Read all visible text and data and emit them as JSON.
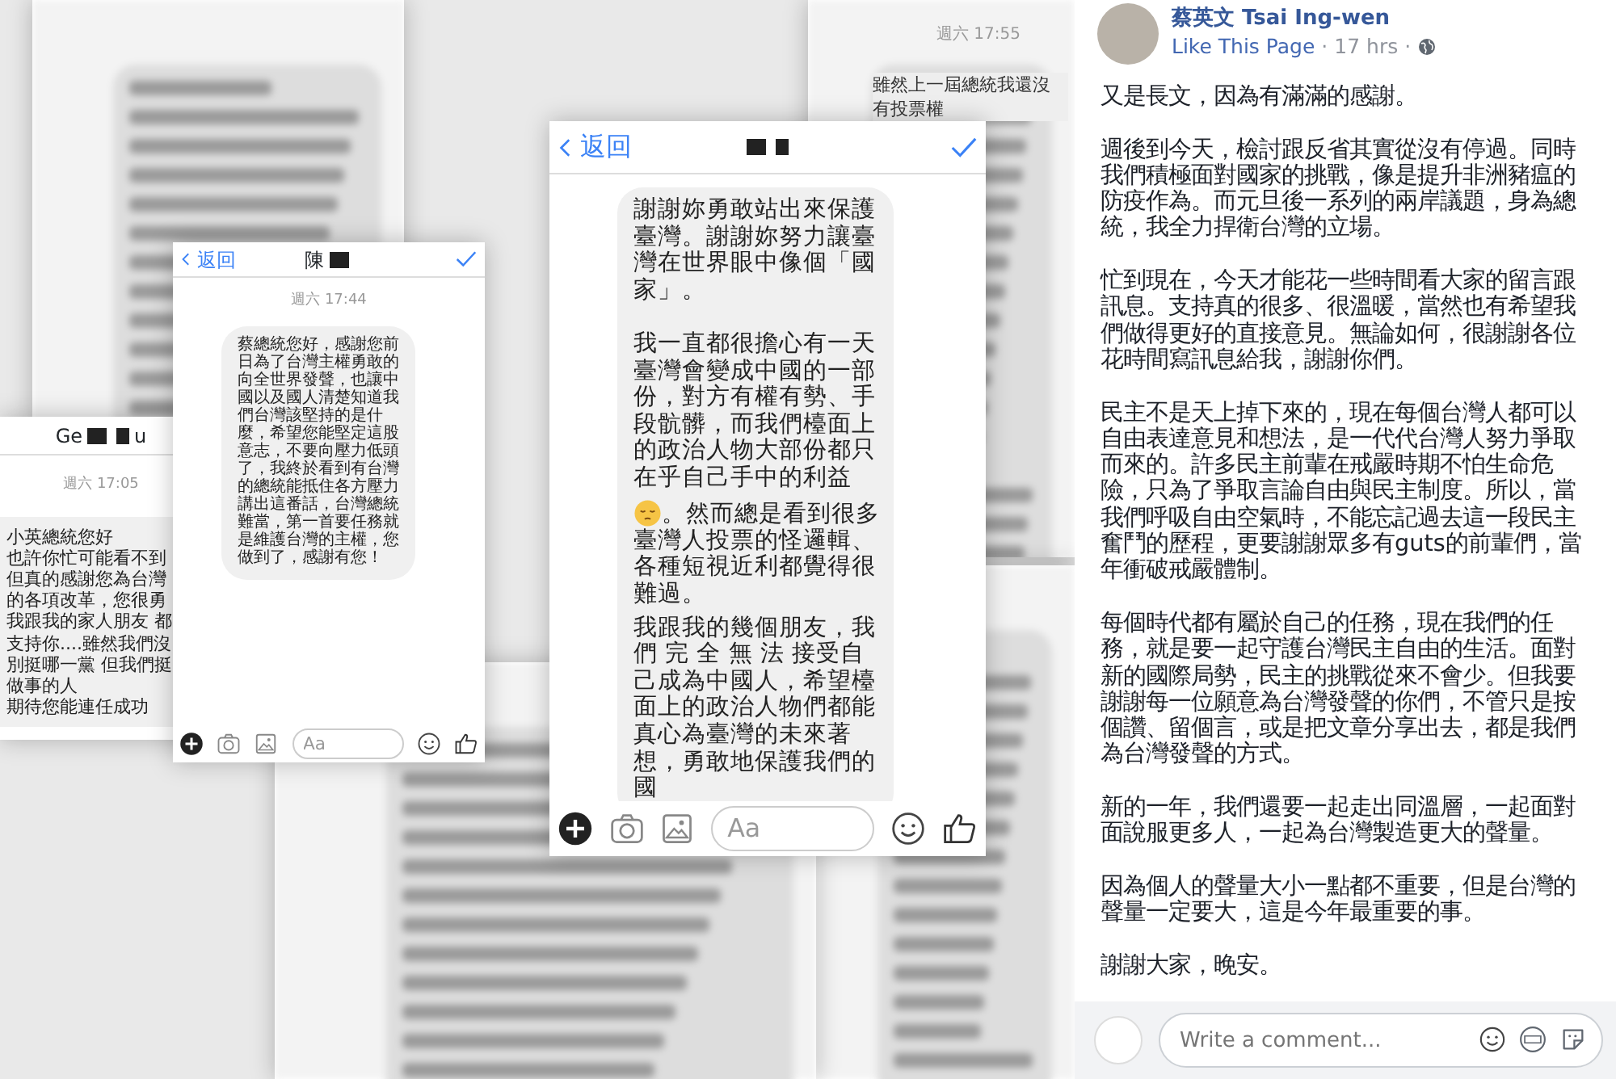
{
  "chats": [
    {
      "kind": "blurred"
    },
    {
      "kind": "blurred",
      "timestamp": "週六 17:55",
      "lines": [
        "雖然上一屆總統我還沒",
        "有投票權"
      ]
    },
    {
      "kind": "blurred"
    },
    {
      "kind": "blurred"
    },
    {
      "kind": "messenger",
      "title_start": "Ge",
      "title_end": "u",
      "timestamp": "週六 17:05",
      "lines": [
        "小英總統您好",
        "也許你忙可能看不到",
        "但真的感謝您為台灣",
        "的各項改革，您很勇",
        "我跟我的家人朋友 都",
        "支持你....雖然我們沒",
        "別挺哪一黨 但我們挺",
        "做事的人",
        "期待您能連任成功"
      ]
    },
    {
      "kind": "messenger",
      "back": "返回",
      "title_start": "陳",
      "timestamp": "週六 17:44",
      "paragraphs": [
        {
          "text": "蔡總統您好，感謝您前日為了台灣主權勇敢的向全世界發聲，也讓中國以及國人清楚知道我們台灣該堅持的是什麼，希望您能堅定這股意志，不要向壓力低頭了，我終於看到有台灣的總統能抵住各方壓力講出這番話，台灣總統難當，第一首要任務就是維護台灣的主權，您做到了，感謝有您！",
          "lead_emoji": false
        }
      ],
      "composer_placeholder": "Aa"
    },
    {
      "kind": "messenger",
      "back": "返回",
      "paragraphs": [
        {
          "text": "謝謝妳勇敢站出來保護臺灣。謝謝妳努力讓臺灣在世界眼中像個「國家」。",
          "lead_emoji": false
        },
        {
          "text": "我一直都很擔心有一天臺灣會變成中國的一部份，對方有權有勢、手段骯髒，而我們檯面上的政治人物大部份都只在乎自己手中的利益",
          "lead_emoji": false
        },
        {
          "text": "。然而總是看到很多臺灣人投票的怪邏輯、各種短視近利都覺得很難過。",
          "lead_emoji": true
        },
        {
          "text": "我跟我的幾個朋友，我們 完 全 無 法 接受自己成為中國人，希望檯面上的政治人物們都能真心為臺灣的未來著想，勇敢地保護我們的國",
          "lead_emoji": false
        }
      ],
      "composer_placeholder": "Aa"
    }
  ],
  "post": {
    "author": "蔡英文 Tsai Ing-wen",
    "like_page": "Like This Page",
    "separators": [
      "·",
      "·"
    ],
    "time": "17 hrs",
    "paragraphs": [
      "又是長文，因為有滿滿的感謝。",
      "週後到今天，檢討跟反省其實從沒有停過。同時我們積極面對國家的挑戰，像是提升非洲豬瘟的防疫作為。而元旦後一系列的兩岸議題，身為總統，我全力捍衛台灣的立場。",
      "忙到現在，今天才能花一些時間看大家的留言跟訊息。支持真的很多、很溫暖，當然也有希望我們做得更好的直接意見。無論如何，很謝謝各位花時間寫訊息給我，謝謝你們。",
      "民主不是天上掉下來的，現在每個台灣人都可以自由表達意見和想法，是一代代台灣人努力爭取而來的。許多民主前輩在戒嚴時期不怕生命危險，只為了爭取言論自由與民主制度。所以，當我們呼吸自由空氣時，不能忘記過去這一段民主奮鬥的歷程，更要謝謝眾多有guts的前輩們，當年衝破戒嚴體制。",
      "每個時代都有屬於自己的任務，現在我們的任務，就是要一起守護台灣民主自由的生活。面對新的國際局勢，民主的挑戰從來不會少。但我要謝謝每一位願意為台灣發聲的你們，不管只是按個讚、留個言，或是把文章分享出去，都是我們為台灣發聲的方式。",
      "新的一年，我們還要一起走出同溫層，一起面對面說服更多人，一起為台灣製造更大的聲量。",
      "因為個人的聲量大小一點都不重要，但是台灣的聲量一定要大，這是今年最重要的事。",
      "謝謝大家，晚安。"
    ],
    "comment_placeholder": "Write a comment..."
  }
}
